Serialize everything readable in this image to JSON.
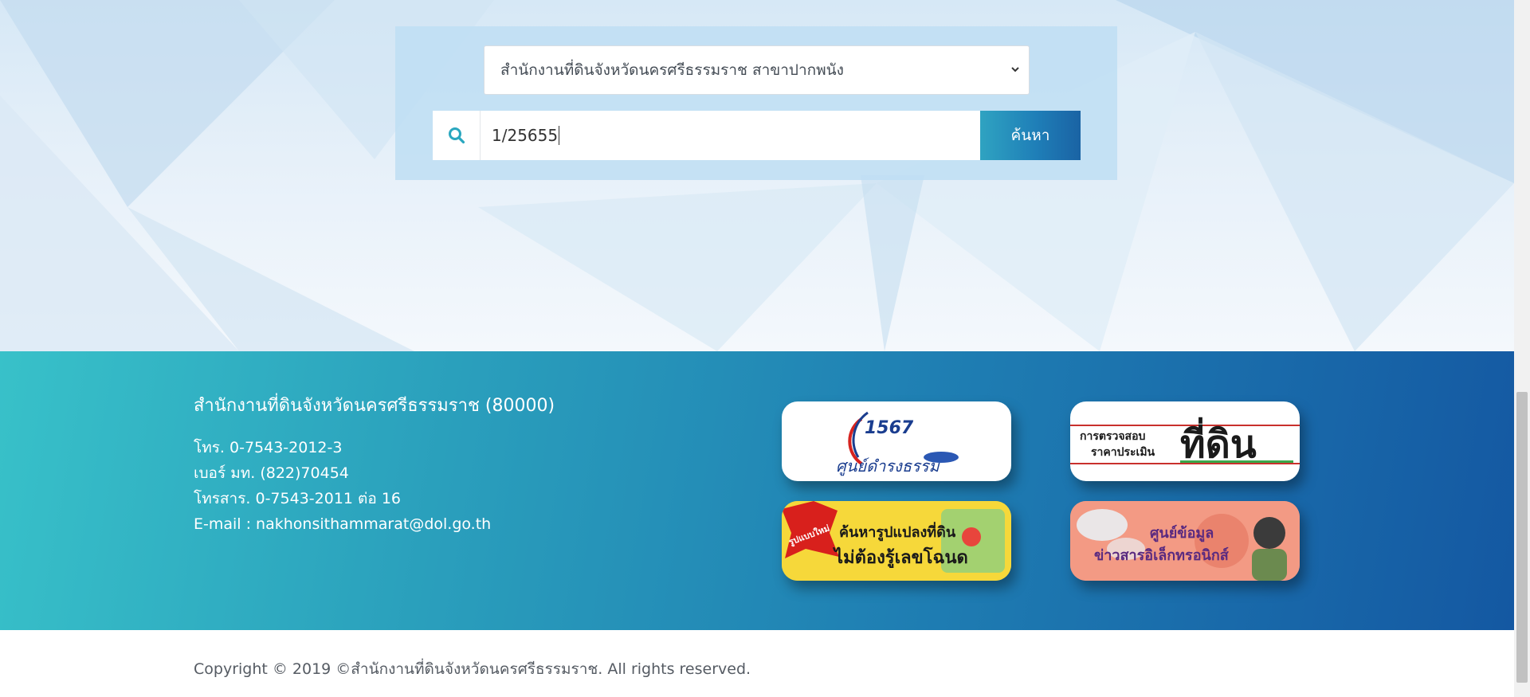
{
  "search": {
    "office_select_value": "สำนักงานที่ดินจังหวัดนครศรีธรรมราช สาขาปากพนัง",
    "parcel_input_value": "1/25655",
    "search_button_label": "ค้นหา"
  },
  "footer": {
    "office_title": "สำนักงานที่ดินจังหวัดนครศรีธรรมราช (80000)",
    "phone": "โทร. 0-7543-2012-3",
    "internal_number": "เบอร์ มท. (822)70454",
    "fax": "โทรสาร. 0-7543-2011 ต่อ 16",
    "email": "E-mail : nakhonsithammarat@dol.go.th",
    "banners": {
      "b1_number": "1567",
      "b1_text": "ศูนย์ดำรงธรรม",
      "b2_line1": "การตรวจสอบ",
      "b2_line2": "ราคาประเมิน",
      "b2_big": "ที่ดิน",
      "b3_badge": "รูปแบบใหม่",
      "b3_line1": "ค้นหารูปแปลงที่ดิน",
      "b3_line2": "ไม่ต้องรู้เลขโฉนด",
      "b4_line1": "ศูนย์ข้อมูล",
      "b4_line2": "ข่าวสารอิเล็กทรอนิกส์"
    }
  },
  "copyright": "Copyright © 2019 ©สำนักงานที่ดินจังหวัดนครศรีธรรมราช. All rights reserved.",
  "colors": {
    "footer_start": "#38c1c9",
    "footer_end": "#1458a2",
    "button_start": "#2fa3c1",
    "button_end": "#1a63a4"
  },
  "icons": {
    "search": "search-icon",
    "select": "chevron-down-icon"
  }
}
